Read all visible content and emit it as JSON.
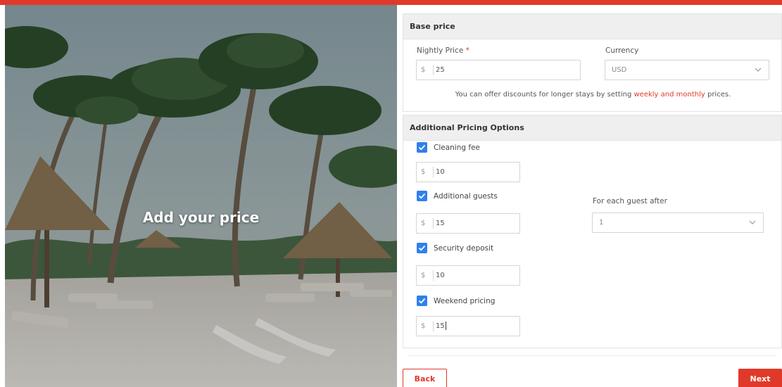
{
  "hero": {
    "title": "Add your price"
  },
  "base_price": {
    "header": "Base price",
    "nightly_label": "Nightly Price",
    "nightly_required": "*",
    "nightly_prefix": "$",
    "nightly_value": "25",
    "currency_label": "Currency",
    "currency_value": "USD",
    "note_before": "You can offer discounts for longer stays by setting ",
    "note_link": "weekly and monthly",
    "note_after": " prices."
  },
  "additional": {
    "header": "Additional Pricing Options",
    "cleaning_label": "Cleaning fee",
    "cleaning_prefix": "$",
    "cleaning_value": "10",
    "guests_label": "Additional guests",
    "guests_prefix": "$",
    "guests_value": "15",
    "guest_after_label": "For each guest after",
    "guest_after_value": "1",
    "security_label": "Security deposit",
    "security_prefix": "$",
    "security_value": "10",
    "weekend_label": "Weekend pricing",
    "weekend_prefix": "$",
    "weekend_value": "15"
  },
  "nav": {
    "back_label": "Back",
    "next_label": "Next"
  },
  "colors": {
    "accent": "#e0392a",
    "checkbox": "#2f80ed"
  },
  "icons": {
    "check": "check-icon",
    "chevron": "chevron-down-icon"
  }
}
